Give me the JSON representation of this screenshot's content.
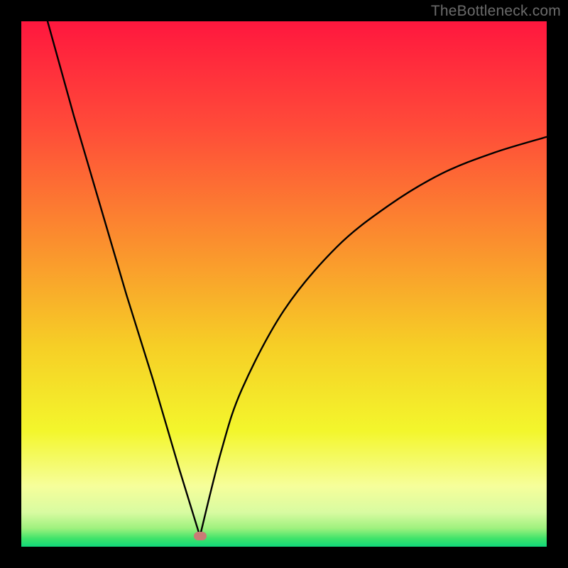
{
  "watermark": {
    "text": "TheBottleneck.com"
  },
  "chart_data": {
    "type": "line",
    "title": "",
    "xlabel": "",
    "ylabel": "",
    "xlim": [
      0,
      100
    ],
    "ylim": [
      0,
      100
    ],
    "curve": {
      "description": "V-shaped bottleneck curve",
      "cusp_x": 34,
      "cusp_y": 2,
      "left_branch": [
        {
          "x": 5,
          "y": 100
        },
        {
          "x": 10,
          "y": 82
        },
        {
          "x": 15,
          "y": 65
        },
        {
          "x": 20,
          "y": 48
        },
        {
          "x": 25,
          "y": 32
        },
        {
          "x": 30,
          "y": 15
        },
        {
          "x": 34,
          "y": 2
        }
      ],
      "right_branch": [
        {
          "x": 34,
          "y": 2
        },
        {
          "x": 38,
          "y": 18
        },
        {
          "x": 42,
          "y": 30
        },
        {
          "x": 50,
          "y": 45
        },
        {
          "x": 60,
          "y": 57
        },
        {
          "x": 70,
          "y": 65
        },
        {
          "x": 80,
          "y": 71
        },
        {
          "x": 90,
          "y": 75
        },
        {
          "x": 100,
          "y": 78
        }
      ]
    },
    "marker": {
      "x": 34,
      "y": 2,
      "color": "#c97b76"
    },
    "background_gradient": {
      "stops": [
        {
          "pos": 0,
          "color": "#ff173e"
        },
        {
          "pos": 0.2,
          "color": "#ff4b39"
        },
        {
          "pos": 0.42,
          "color": "#fb8f2e"
        },
        {
          "pos": 0.62,
          "color": "#f6cf26"
        },
        {
          "pos": 0.78,
          "color": "#f3f62c"
        },
        {
          "pos": 0.885,
          "color": "#f6fe9b"
        },
        {
          "pos": 0.935,
          "color": "#d8fba1"
        },
        {
          "pos": 0.965,
          "color": "#9ef17e"
        },
        {
          "pos": 0.985,
          "color": "#3de36a"
        },
        {
          "pos": 1.0,
          "color": "#11d87b"
        }
      ]
    }
  }
}
